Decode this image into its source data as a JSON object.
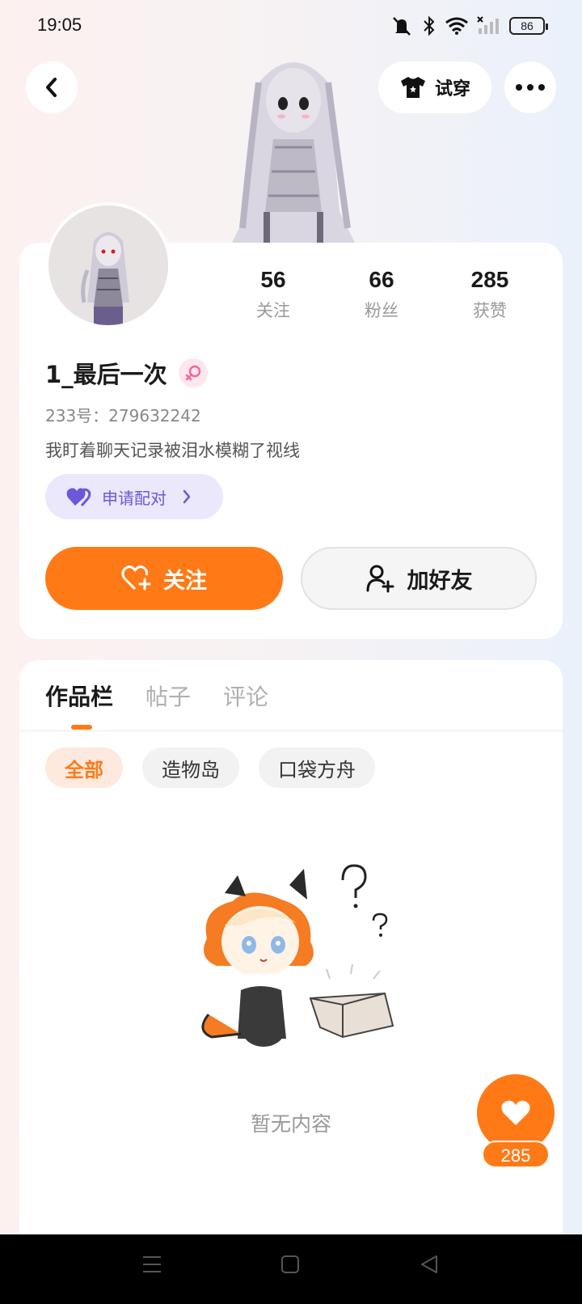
{
  "status_bar": {
    "time": "19:05",
    "battery": "86"
  },
  "header": {
    "tryon_label": "试穿"
  },
  "profile": {
    "stats": [
      {
        "value": "56",
        "label": "关注"
      },
      {
        "value": "66",
        "label": "粉丝"
      },
      {
        "value": "285",
        "label": "获赞"
      }
    ],
    "username": "1_最后一次",
    "user_id": "233号：279632242",
    "bio": "我盯着聊天记录被泪水模糊了视线",
    "match_label": "申请配对",
    "follow_label": "关注",
    "add_friend_label": "加好友"
  },
  "works": {
    "tabs": [
      "作品栏",
      "帖子",
      "评论"
    ],
    "chips": [
      "全部",
      "造物岛",
      "口袋方舟"
    ],
    "empty_text": "暂无内容"
  },
  "like_fab": {
    "count": "285"
  },
  "colors": {
    "accent": "#ff7a17",
    "match": "#6b58d8",
    "gender": "#f06a9a"
  },
  "icons": [
    "back-icon",
    "shirt-icon",
    "more-icon",
    "female-icon",
    "heart-pair-icon",
    "heart-plus-icon",
    "user-plus-icon",
    "heart-icon",
    "menu-icon",
    "home-square-icon",
    "back-triangle-icon"
  ]
}
